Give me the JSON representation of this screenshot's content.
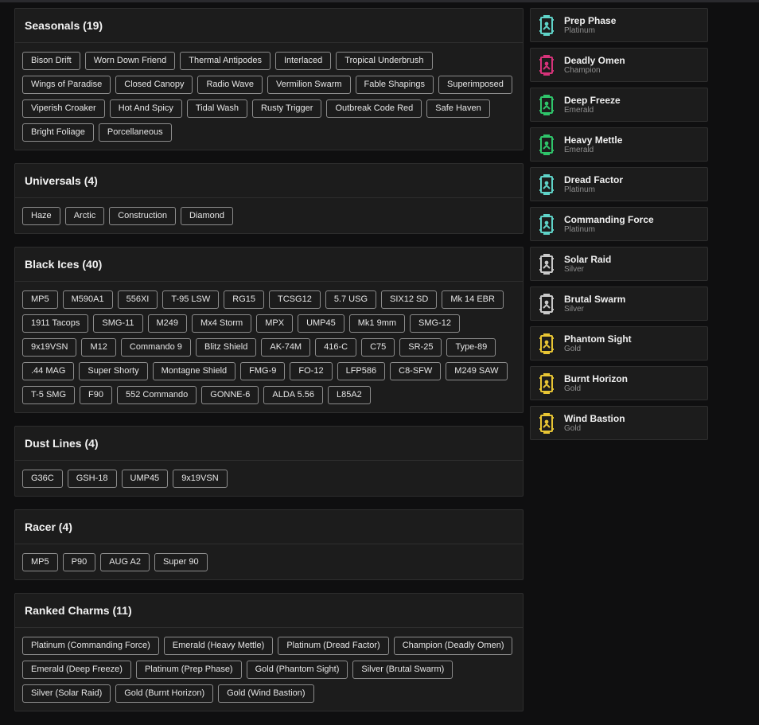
{
  "sections": [
    {
      "title": "Seasonals (19)",
      "items": [
        "Bison Drift",
        "Worn Down Friend",
        "Thermal Antipodes",
        "Interlaced",
        "Tropical Underbrush",
        "Wings of Paradise",
        "Closed Canopy",
        "Radio Wave",
        "Vermilion Swarm",
        "Fable Shapings",
        "Superimposed",
        "Viperish Croaker",
        "Hot And Spicy",
        "Tidal Wash",
        "Rusty Trigger",
        "Outbreak Code Red",
        "Safe Haven",
        "Bright Foliage",
        "Porcellaneous"
      ]
    },
    {
      "title": "Universals (4)",
      "items": [
        "Haze",
        "Arctic",
        "Construction",
        "Diamond"
      ]
    },
    {
      "title": "Black Ices (40)",
      "items": [
        "MP5",
        "M590A1",
        "556XI",
        "T-95 LSW",
        "RG15",
        "TCSG12",
        "5.7 USG",
        "SIX12 SD",
        "Mk 14 EBR",
        "1911 Tacops",
        "SMG-11",
        "M249",
        "Mx4 Storm",
        "MPX",
        "UMP45",
        "Mk1 9mm",
        "SMG-12",
        "9x19VSN",
        "M12",
        "Commando 9",
        "Blitz Shield",
        "AK-74M",
        "416-C",
        "C75",
        "SR-25",
        "Type-89",
        ".44 MAG",
        "Super Shorty",
        "Montagne Shield",
        "FMG-9",
        "FO-12",
        "LFP586",
        "C8-SFW",
        "M249 SAW",
        "T-5 SMG",
        "F90",
        "552 Commando",
        "GONNE-6",
        "ALDA 5.56",
        "L85A2"
      ]
    },
    {
      "title": "Dust Lines (4)",
      "items": [
        "G36C",
        "GSH-18",
        "UMP45",
        "9x19VSN"
      ]
    },
    {
      "title": "Racer (4)",
      "items": [
        "MP5",
        "P90",
        "AUG A2",
        "Super 90"
      ]
    },
    {
      "title": "Ranked Charms (11)",
      "items": [
        "Platinum (Commanding Force)",
        "Emerald (Heavy Mettle)",
        "Platinum (Dread Factor)",
        "Champion (Deadly Omen)",
        "Emerald (Deep Freeze)",
        "Platinum (Prep Phase)",
        "Gold (Phantom Sight)",
        "Silver (Brutal Swarm)",
        "Silver (Solar Raid)",
        "Gold (Burnt Horizon)",
        "Gold (Wind Bastion)"
      ]
    }
  ],
  "seasons": [
    {
      "name": "Prep Phase",
      "tier": "Platinum",
      "icon": "platinum-rank-icon",
      "color": "#5fd3c8"
    },
    {
      "name": "Deadly Omen",
      "tier": "Champion",
      "icon": "champion-rank-icon",
      "color": "#d6337a"
    },
    {
      "name": "Deep Freeze",
      "tier": "Emerald",
      "icon": "emerald-rank-icon",
      "color": "#2fc46a"
    },
    {
      "name": "Heavy Mettle",
      "tier": "Emerald",
      "icon": "emerald-rank-icon",
      "color": "#2fc46a"
    },
    {
      "name": "Dread Factor",
      "tier": "Platinum",
      "icon": "platinum-rank-icon",
      "color": "#5fd3c8"
    },
    {
      "name": "Commanding Force",
      "tier": "Platinum",
      "icon": "platinum-rank-icon",
      "color": "#5fd3c8"
    },
    {
      "name": "Solar Raid",
      "tier": "Silver",
      "icon": "silver-rank-icon",
      "color": "#c9c9c9"
    },
    {
      "name": "Brutal Swarm",
      "tier": "Silver",
      "icon": "silver-rank-icon",
      "color": "#c9c9c9"
    },
    {
      "name": "Phantom Sight",
      "tier": "Gold",
      "icon": "gold-rank-icon",
      "color": "#e8c534"
    },
    {
      "name": "Burnt Horizon",
      "tier": "Gold",
      "icon": "gold-rank-icon",
      "color": "#e8c534"
    },
    {
      "name": "Wind Bastion",
      "tier": "Gold",
      "icon": "gold-rank-icon",
      "color": "#e8c534"
    }
  ]
}
